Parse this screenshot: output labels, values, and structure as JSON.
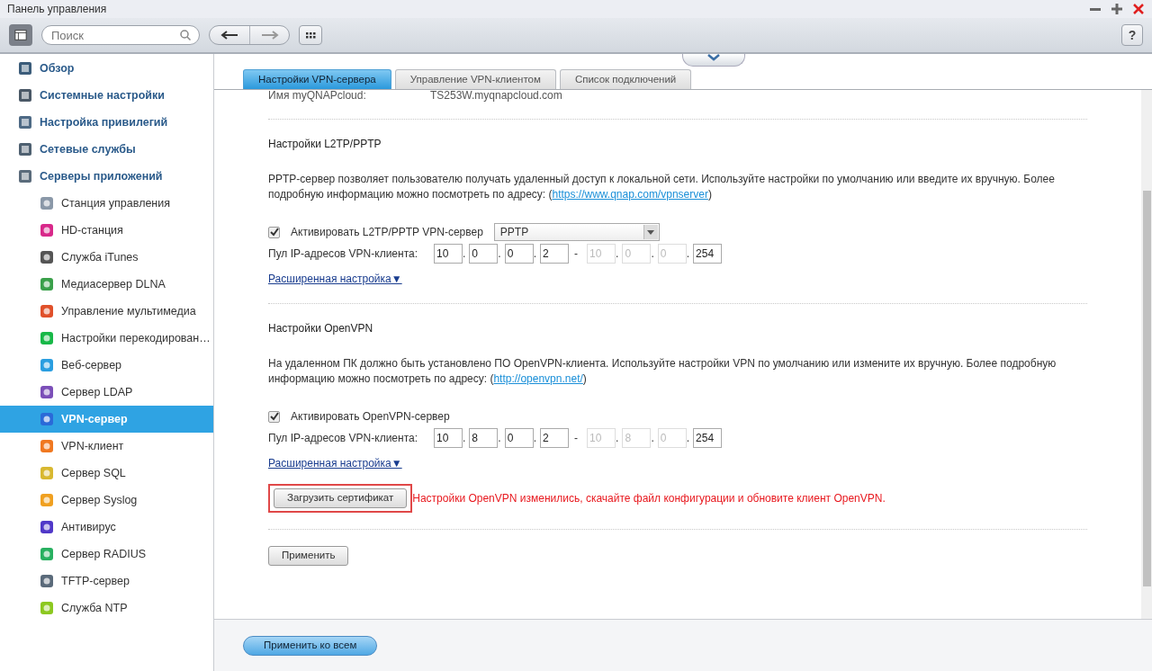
{
  "window": {
    "title": "Панель управления"
  },
  "toolbar": {
    "search": {
      "placeholder": "Поиск"
    },
    "help": "?"
  },
  "sidebar": {
    "items": [
      {
        "label": "Обзор",
        "selected": false
      },
      {
        "label": "Системные настройки",
        "selected": false
      },
      {
        "label": "Настройка привилегий",
        "selected": false
      },
      {
        "label": "Сетевые службы",
        "selected": false
      },
      {
        "label": "Серверы приложений",
        "selected": false,
        "children": [
          {
            "label": "Станция управления",
            "selected": false
          },
          {
            "label": "HD-станция",
            "selected": false
          },
          {
            "label": "Служба iTunes",
            "selected": false
          },
          {
            "label": "Медиасервер DLNA",
            "selected": false
          },
          {
            "label": "Управление мультимедиа",
            "selected": false
          },
          {
            "label": "Настройки перекодирован…",
            "selected": false
          },
          {
            "label": "Веб-сервер",
            "selected": false
          },
          {
            "label": "Сервер LDAP",
            "selected": false
          },
          {
            "label": "VPN-сервер",
            "selected": true
          },
          {
            "label": "VPN-клиент",
            "selected": false
          },
          {
            "label": "Сервер SQL",
            "selected": false
          },
          {
            "label": "Сервер Syslog",
            "selected": false
          },
          {
            "label": "Антивирус",
            "selected": false
          },
          {
            "label": "Сервер RADIUS",
            "selected": false
          },
          {
            "label": "TFTP-сервер",
            "selected": false
          },
          {
            "label": "Служба NTP",
            "selected": false
          }
        ]
      }
    ]
  },
  "tabs": [
    {
      "label": "Настройки VPN-сервера",
      "selected": true
    },
    {
      "label": "Управление VPN-клиентом",
      "selected": false
    },
    {
      "label": "Список подключений",
      "selected": false
    }
  ],
  "cloud_row": {
    "label": "Имя myQNAPcloud:",
    "value": "TS253W.myqnapcloud.com"
  },
  "sections": [
    {
      "title": "Настройки L2TP/PPTP",
      "description": "PPTP-сервер позволяет пользователю получать удаленный доступ к локальной сети. Используйте настройки по умолчанию или введите их вручную. Более подробную информацию можно посмотреть по адресу: (",
      "link": "https://www.qnap.com/vpnserver",
      "description_end": ")",
      "enable": {
        "label": "Активировать L2TP/PPTP VPN-сервер",
        "checked": true
      },
      "protocol": "PPTP",
      "pool_label": "Пул IP-адресов VPN-клиента:",
      "octet_separator": ".",
      "range_separator": "-",
      "pool_start": [
        {
          "value": "10",
          "disabled": false
        },
        {
          "value": "0",
          "disabled": false
        },
        {
          "value": "0",
          "disabled": false
        },
        {
          "value": "2",
          "disabled": false
        }
      ],
      "pool_end": [
        {
          "value": "10",
          "disabled": true
        },
        {
          "value": "0",
          "disabled": true
        },
        {
          "value": "0",
          "disabled": true
        },
        {
          "value": "254",
          "disabled": false
        }
      ],
      "advanced": "Расширенная настройка▼"
    },
    {
      "title": "Настройки OpenVPN",
      "description": "На удаленном ПК должно быть установлено ПО OpenVPN-клиента. Используйте настройки VPN по умолчанию или измените их вручную. Более подробную информацию можно посмотреть по адресу: (",
      "link": "http://openvpn.net/",
      "description_end": ")",
      "enable": {
        "label": "Активировать OpenVPN-сервер",
        "checked": true
      },
      "pool_label": "Пул IP-адресов VPN-клиента:",
      "octet_separator": ".",
      "range_separator": "-",
      "pool_start": [
        {
          "value": "10",
          "disabled": false
        },
        {
          "value": "8",
          "disabled": false
        },
        {
          "value": "0",
          "disabled": false
        },
        {
          "value": "2",
          "disabled": false
        }
      ],
      "pool_end": [
        {
          "value": "10",
          "disabled": true
        },
        {
          "value": "8",
          "disabled": true
        },
        {
          "value": "0",
          "disabled": true
        },
        {
          "value": "254",
          "disabled": false
        }
      ],
      "advanced": "Расширенная настройка▼",
      "certificate_button": {
        "label": "Загрузить сертификат",
        "highlighted": true
      },
      "warning": "Настройки OpenVPN изменились, скачайте файл конфигурации и обновите клиент OpenVPN."
    }
  ],
  "apply": "Применить",
  "footer": {
    "apply_all": "Применить ко всем"
  }
}
